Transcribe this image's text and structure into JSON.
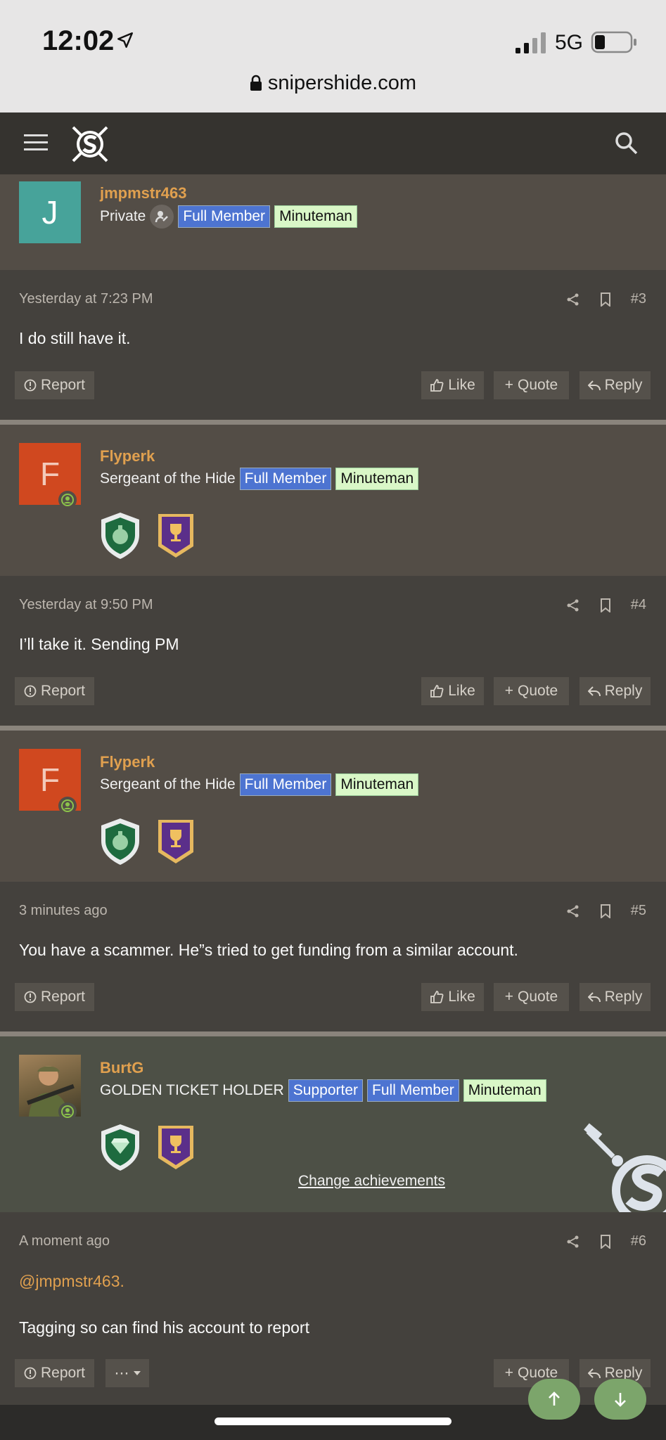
{
  "status_bar": {
    "time": "12:02",
    "network": "5G"
  },
  "browser": {
    "url": "snipershide.com"
  },
  "posts": [
    {
      "username": "jmpmstr463",
      "rank_title": "Private",
      "badges": [
        "Full Member",
        "Minuteman"
      ],
      "date": "Yesterday at 7:23 PM",
      "number": "#3",
      "message": "I do still have it."
    },
    {
      "avatar_letter": "F",
      "username": "Flyperk",
      "rank_title": "Sergeant of the Hide",
      "badges": [
        "Full Member",
        "Minuteman"
      ],
      "date": "Yesterday at 9:50 PM",
      "number": "#4",
      "message": "I’ll take it. Sending PM"
    },
    {
      "avatar_letter": "F",
      "username": "Flyperk",
      "rank_title": "Sergeant of the Hide",
      "badges": [
        "Full Member",
        "Minuteman"
      ],
      "date": "3 minutes ago",
      "number": "#5",
      "message": "You have a scammer. He”s tried to get funding from a similar account."
    },
    {
      "username": "BurtG",
      "rank_title": "GOLDEN TICKET HOLDER",
      "badges": [
        "Supporter",
        "Full Member",
        "Minuteman"
      ],
      "date": "A moment ago",
      "number": "#6",
      "mention": "@jmpmstr463.",
      "message": "Tagging so can find his account to report"
    }
  ],
  "first_avatar_letter": "J",
  "actions": {
    "report": "Report",
    "like": "Like",
    "quote": "Quote",
    "reply": "Reply",
    "more": "⋯"
  },
  "change_achievements": "Change achievements",
  "colors": {
    "username": "#e0a04f",
    "badge_blue": "#4d74d1",
    "badge_green": "#d9f7c7",
    "float_button": "#7ca56b"
  }
}
